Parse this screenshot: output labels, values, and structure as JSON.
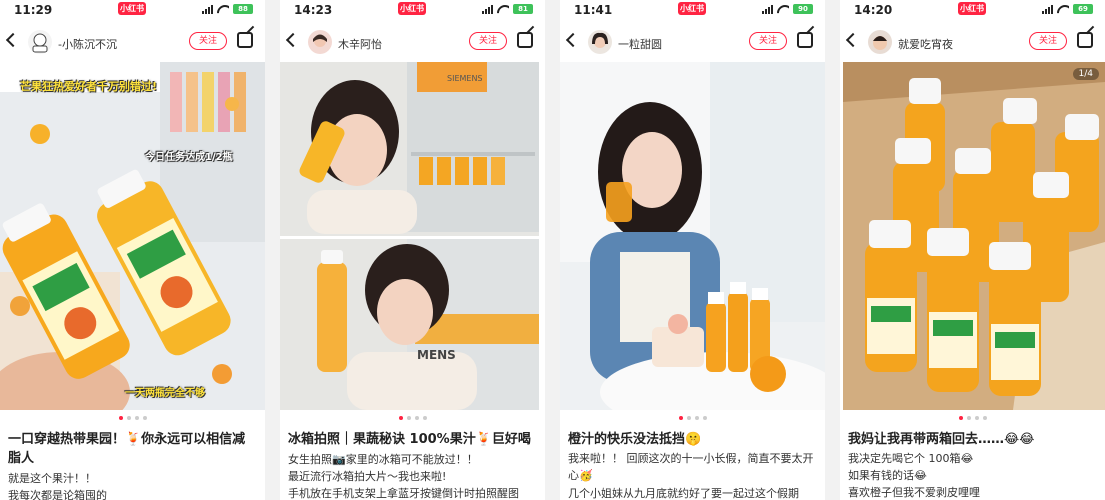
{
  "posts": [
    {
      "status": {
        "time": "11:29",
        "badge": "小红书",
        "battery": "88"
      },
      "user": {
        "name": "-小陈沉不沉"
      },
      "follow_label": "关注",
      "overlay": {
        "top": "芒果狂热爱好者千万别错过!",
        "mid": "今日任务达成1/2瓶",
        "bottom": "一天两瓶完全不够"
      },
      "bottle_label": "每日两瓶 补C不掉队",
      "title": "一口穿越热带果园！🍹你永远可以相信减脂人",
      "lines": [
        "就是这个果汁！！",
        "我每次都是论箱囤的"
      ]
    },
    {
      "status": {
        "time": "14:23",
        "badge": "小红书",
        "battery": "81"
      },
      "user": {
        "name": "木辛阿怡"
      },
      "follow_label": "关注",
      "fridge_brand": "SIEMENS",
      "fridge_brand2": "MENS",
      "title": "冰箱拍照｜果蔬秘诀 100%果汁🍹巨好喝",
      "lines": [
        "女生拍照📷家里的冰箱可不能放过！！",
        "最近流行冰箱拍大片～我也来啦!",
        "手机放在手机支架上拿蓝牙按键倒计时拍照醒图"
      ]
    },
    {
      "status": {
        "time": "11:41",
        "badge": "小红书",
        "battery": "90"
      },
      "user": {
        "name": "一粒甜圆"
      },
      "follow_label": "关注",
      "title": "橙汁的快乐没法抵挡🤫",
      "lines": [
        "我来啦！！ 回顾这次的十一小长假，简直不要太开心🥳",
        "几个小姐妹从九月底就约好了要一起过这个假期"
      ]
    },
    {
      "status": {
        "time": "14:20",
        "badge": "小红书",
        "battery": "69"
      },
      "user": {
        "name": "就爱吃宵夜"
      },
      "follow_label": "关注",
      "counter": "1/4",
      "title": "我妈让我再带两箱回去……😂😂",
      "lines": [
        "我决定先喝它个 100箱😂",
        "如果有钱的话😂",
        "喜欢橙子但我不爱剥皮哩哩"
      ]
    }
  ],
  "colors": {
    "accent": "#ff2442",
    "juice": "#f5a623",
    "status_battery": "#3ec25a"
  },
  "icons": [
    "back-icon",
    "share-icon",
    "signal-icon",
    "wifi-icon",
    "battery-icon"
  ]
}
